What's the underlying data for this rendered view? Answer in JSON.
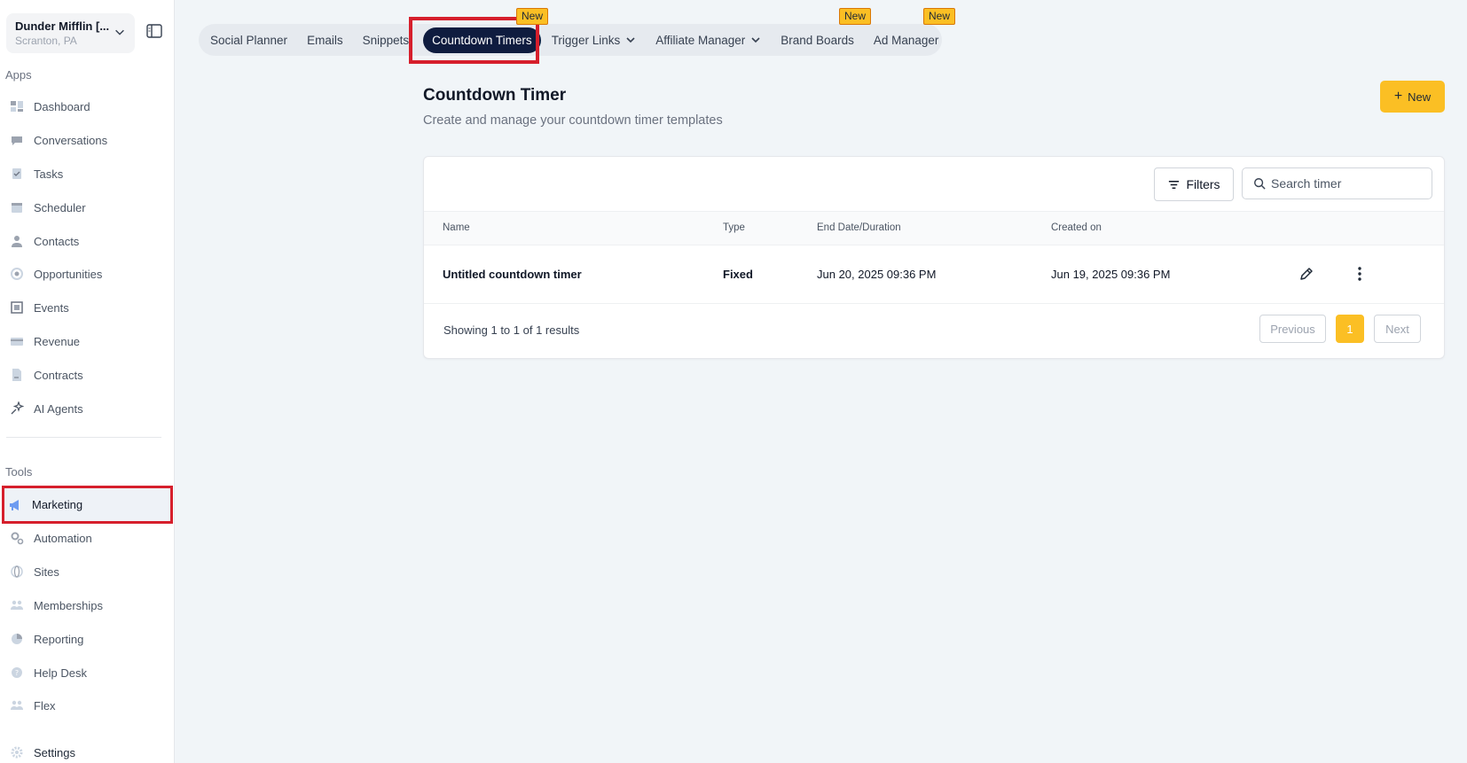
{
  "location": {
    "name": "Dunder Mifflin [...",
    "subtitle": "Scranton, PA"
  },
  "sidebar": {
    "apps_label": "Apps",
    "apps": [
      {
        "label": "Dashboard",
        "icon": "dashboard-icon"
      },
      {
        "label": "Conversations",
        "icon": "chat-icon"
      },
      {
        "label": "Tasks",
        "icon": "task-icon"
      },
      {
        "label": "Scheduler",
        "icon": "calendar-icon"
      },
      {
        "label": "Contacts",
        "icon": "user-icon"
      },
      {
        "label": "Opportunities",
        "icon": "target-icon"
      },
      {
        "label": "Events",
        "icon": "events-icon"
      },
      {
        "label": "Revenue",
        "icon": "card-icon"
      },
      {
        "label": "Contracts",
        "icon": "document-icon"
      },
      {
        "label": "AI Agents",
        "icon": "sparkle-icon"
      }
    ],
    "tools_label": "Tools",
    "tools": [
      {
        "label": "Marketing",
        "icon": "megaphone-icon"
      },
      {
        "label": "Automation",
        "icon": "gears-icon"
      },
      {
        "label": "Sites",
        "icon": "globe-icon"
      },
      {
        "label": "Memberships",
        "icon": "people-icon"
      },
      {
        "label": "Reporting",
        "icon": "pie-icon"
      },
      {
        "label": "Help Desk",
        "icon": "help-icon"
      },
      {
        "label": "Flex",
        "icon": "people-icon"
      }
    ],
    "settings_label": "Settings"
  },
  "tabs": [
    {
      "label": "Social Planner"
    },
    {
      "label": "Emails"
    },
    {
      "label": "Snippets"
    },
    {
      "label": "Countdown Timers",
      "active": true,
      "badge": "New"
    },
    {
      "label": "Trigger Links",
      "dropdown": true
    },
    {
      "label": "Affiliate Manager",
      "dropdown": true
    },
    {
      "label": "Brand Boards",
      "badge": "New"
    },
    {
      "label": "Ad Manager",
      "badge": "New"
    }
  ],
  "page": {
    "title": "Countdown Timer",
    "subtitle": "Create and manage your countdown timer templates",
    "new_button": "New"
  },
  "table": {
    "filters_label": "Filters",
    "search_placeholder": "Search timer",
    "columns": [
      "Name",
      "Type",
      "End Date/Duration",
      "Created on"
    ],
    "rows": [
      {
        "name": "Untitled countdown timer",
        "type": "Fixed",
        "end": "Jun 20, 2025 09:36 PM",
        "created": "Jun 19, 2025 09:36 PM"
      }
    ],
    "summary": "Showing 1 to 1 of 1 results",
    "pagination": {
      "previous": "Previous",
      "page": "1",
      "next": "Next"
    }
  },
  "colors": {
    "accent": "#fbbf24",
    "active_tab": "#0f1c3f",
    "highlight": "#d61f2c"
  }
}
